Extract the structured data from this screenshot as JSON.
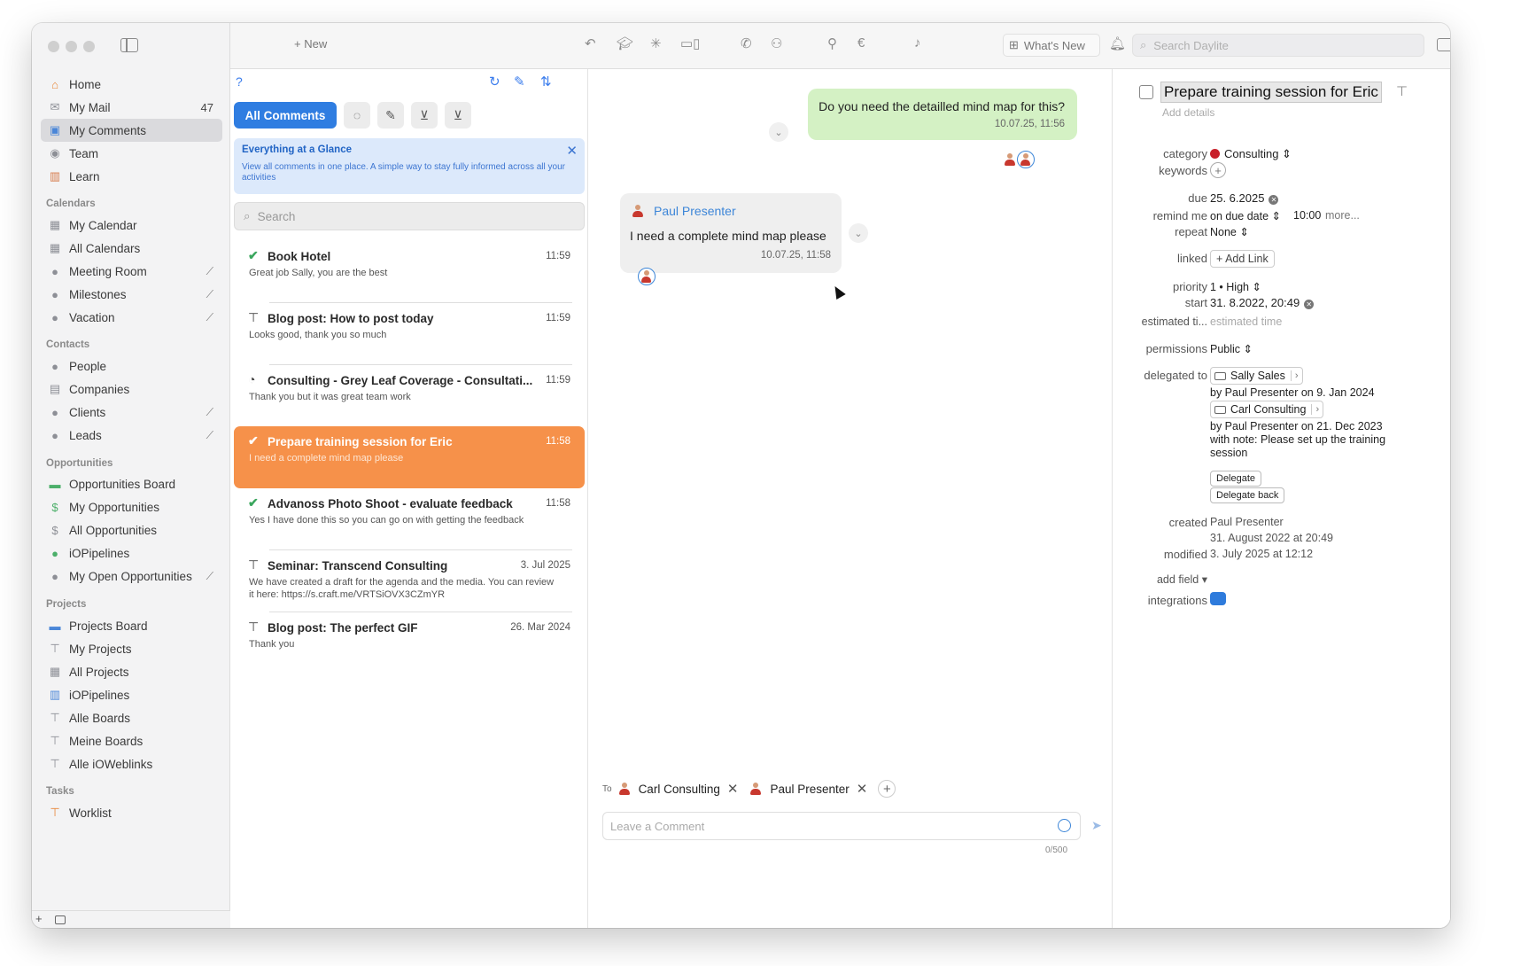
{
  "toolbar": {
    "new_label": "+ New",
    "whats_new": "What's New",
    "search_placeholder": "Search Daylite"
  },
  "sidebar": {
    "top": [
      {
        "label": "Home",
        "icon": "house-icon"
      },
      {
        "label": "My Mail",
        "count": "47",
        "icon": "mail-icon"
      },
      {
        "label": "My Comments",
        "icon": "comments-icon",
        "selected": true
      },
      {
        "label": "Team",
        "icon": "team-icon"
      },
      {
        "label": "Learn",
        "icon": "books-icon"
      }
    ],
    "calendars_title": "Calendars",
    "calendars": [
      {
        "label": "My Calendar"
      },
      {
        "label": "All Calendars"
      },
      {
        "label": "Meeting Room",
        "sync": true
      },
      {
        "label": "Milestones",
        "sync": true
      },
      {
        "label": "Vacation",
        "sync": true
      }
    ],
    "contacts_title": "Contacts",
    "contacts": [
      {
        "label": "People"
      },
      {
        "label": "Companies"
      },
      {
        "label": "Clients",
        "sync": true
      },
      {
        "label": "Leads",
        "sync": true
      }
    ],
    "opportunities_title": "Opportunities",
    "opportunities": [
      {
        "label": "Opportunities Board"
      },
      {
        "label": "My Opportunities"
      },
      {
        "label": "All Opportunities"
      },
      {
        "label": "iOPipelines"
      },
      {
        "label": "My Open Opportunities",
        "sync": true
      }
    ],
    "projects_title": "Projects",
    "projects": [
      {
        "label": "Projects Board"
      },
      {
        "label": "My Projects"
      },
      {
        "label": "All Projects"
      },
      {
        "label": "iOPipelines"
      },
      {
        "label": "Alle Boards"
      },
      {
        "label": "Meine Boards"
      },
      {
        "label": "Alle iOWeblinks"
      }
    ],
    "tasks_title": "Tasks",
    "tasks": [
      {
        "label": "Worklist"
      }
    ]
  },
  "list": {
    "help": "?",
    "filter_all": "All Comments",
    "glance_title": "Everything at a Glance",
    "glance_text": "View all comments in one place. A simple way to stay fully informed across all your activities",
    "search_placeholder": "Search",
    "items": [
      {
        "icon": "check",
        "title": "Book Hotel",
        "time": "11:59",
        "sub": "Great job Sally, you are the best"
      },
      {
        "icon": "project",
        "title": "Blog post: How to post today",
        "time": "11:59",
        "sub": "Looks good, thank you so much"
      },
      {
        "icon": "opportunity",
        "title": "Consulting - Grey Leaf Coverage - Consultati...",
        "time": "11:59",
        "sub": "Thank you but it was great team work"
      },
      {
        "icon": "check",
        "title": "Prepare training session for Eric",
        "time": "11:58",
        "sub": "I need a complete mind map please",
        "selected": true
      },
      {
        "icon": "check",
        "title": "Advanoss Photo Shoot - evaluate feedback",
        "time": "11:58",
        "sub": "Yes I have done this so you can go on with getting the feedback"
      },
      {
        "icon": "project",
        "title": "Seminar: Transcend Consulting",
        "time": "3. Jul 2025",
        "sub": "We have created a draft for the agenda and the media. You can review it here: https://s.craft.me/VRTSiOVX3CZmYR"
      },
      {
        "icon": "project",
        "title": "Blog post: The perfect GIF",
        "time": "26. Mar 2024",
        "sub": "Thank you"
      }
    ]
  },
  "chat": {
    "out_text": "Do you need the detailled mind map for this?",
    "out_time": "10.07.25, 11:56",
    "in_name": "Paul Presenter",
    "in_text": "I need a complete mind map please",
    "in_time": "10.07.25, 11:58",
    "to_label": "To",
    "recipients": [
      "Carl Consulting",
      "Paul Presenter"
    ],
    "comment_placeholder": "Leave a Comment",
    "counter": "0/500"
  },
  "detail": {
    "title": "Prepare training session for Eric",
    "add_details": "Add details",
    "category_label": "category",
    "category": "Consulting",
    "keywords_label": "keywords",
    "due_label": "due",
    "due": "25. 6.2025",
    "remind_label": "remind me",
    "remind": "on due date",
    "remind_time": "10:00",
    "more": "more...",
    "repeat_label": "repeat",
    "repeat": "None",
    "linked_label": "linked",
    "add_link": "+ Add Link",
    "priority_label": "priority",
    "priority": "1 • High",
    "start_label": "start",
    "start": "31. 8.2022, 20:49",
    "estimated_label": "estimated ti...",
    "estimated": "estimated time",
    "permissions_label": "permissions",
    "permissions": "Public",
    "delegated_label": "delegated to",
    "delegate1": "Sally Sales",
    "delegate1_by": "by Paul Presenter on 9. Jan 2024",
    "delegate2": "Carl Consulting",
    "delegate2_by": "by Paul Presenter on 21. Dec 2023 with note: Please set up the training session",
    "delegate_btn": "Delegate",
    "delegate_back_btn": "Delegate back",
    "created_label": "created",
    "created_by": "Paul Presenter",
    "created_at": "31. August 2022 at 20:49",
    "modified_label": "modified",
    "modified_at": "3. July 2025 at 12:12",
    "add_field": "add field ▾",
    "integrations_label": "integrations"
  },
  "colors": {
    "accent": "#2f7de1",
    "selected_row": "#f6914a",
    "outgoing_bubble": "#d4f1c4",
    "check_green": "#3aa65d"
  }
}
